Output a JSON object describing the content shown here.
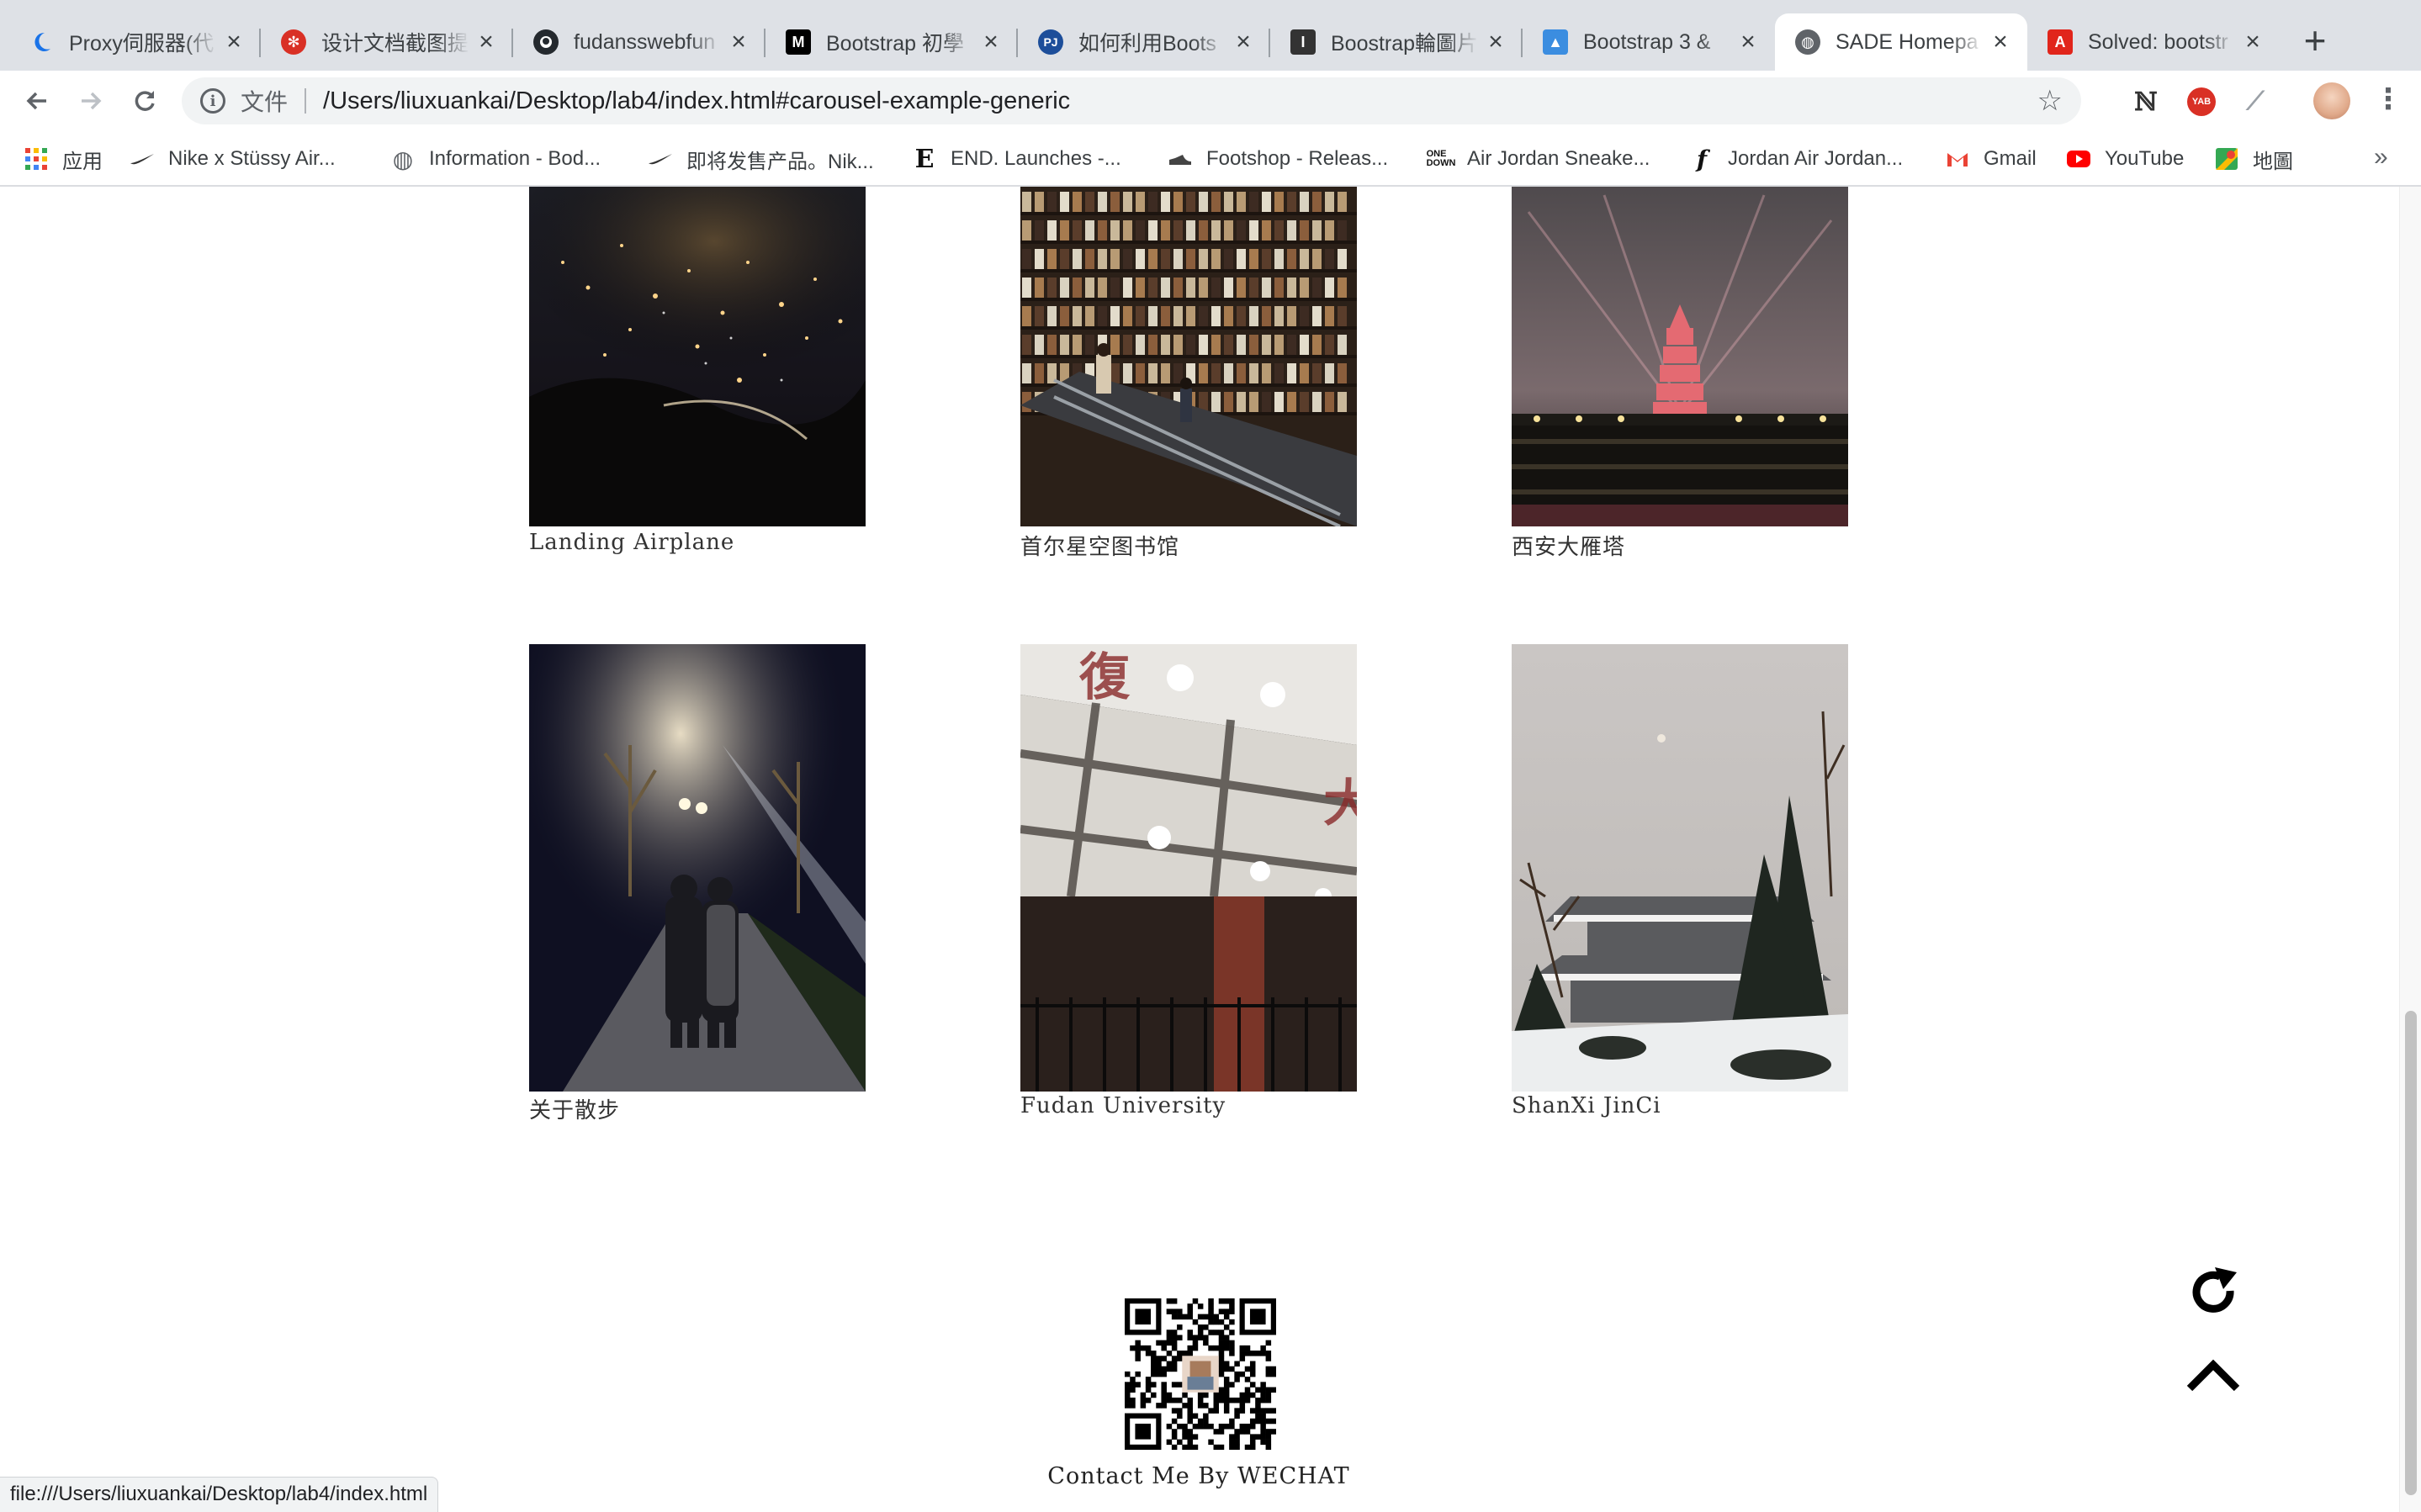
{
  "browser": {
    "tabs": [
      {
        "title": "Proxy伺服器(代",
        "icon": "proxy-moon-icon",
        "color": "#1a73e8"
      },
      {
        "title": "设计文档截图提",
        "icon": "red-snowflake-icon",
        "color": "#d93025"
      },
      {
        "title": "fudansswebfun",
        "icon": "github-icon",
        "color": "#24292e"
      },
      {
        "title": "Bootstrap 初學",
        "icon": "medium-icon",
        "color": "#000000"
      },
      {
        "title": "如何利用Boots",
        "icon": "pj-icon",
        "color": "#1d4e9a"
      },
      {
        "title": "Boostrap輪圖片",
        "icon": "blog-icon",
        "color": "#333333"
      },
      {
        "title": "Bootstrap 3 & ",
        "icon": "image-icon",
        "color": "#3b8de0"
      },
      {
        "title": "SADE Homepa",
        "icon": "globe-icon",
        "color": "#5f6368"
      },
      {
        "title": "Solved: bootstr",
        "icon": "adobe-icon",
        "color": "#e1251b"
      }
    ],
    "active_tab_index": 7,
    "new_tab_label": "+",
    "omnibox": {
      "security_label": "文件",
      "url": "/Users/liuxuankai/Desktop/lab4/index.html#carousel-example-generic"
    },
    "bookmarks": [
      {
        "label": "应用",
        "icon": "apps-grid-icon"
      },
      {
        "label": "Nike x Stüssy Air...",
        "icon": "nike-swoosh-icon"
      },
      {
        "label": "Information - Bod...",
        "icon": "globe-icon"
      },
      {
        "label": "即将发售产品。Nik...",
        "icon": "nike-swoosh-icon"
      },
      {
        "label": "END. Launches -...",
        "icon": "end-logo-icon"
      },
      {
        "label": "Footshop - Releas...",
        "icon": "footshop-icon"
      },
      {
        "label": "Air Jordan Sneake...",
        "icon": "one-block-down-icon"
      },
      {
        "label": "Jordan Air Jordan...",
        "icon": "f-logo-icon"
      },
      {
        "label": "Gmail",
        "icon": "gmail-icon"
      },
      {
        "label": "YouTube",
        "icon": "youtube-icon"
      },
      {
        "label": "地圖",
        "icon": "maps-icon"
      }
    ],
    "status_url": "file:///Users/liuxuankai/Desktop/lab4/index.html"
  },
  "gallery": {
    "items": [
      {
        "caption": "Landing Airplane",
        "image": "night-city-lights"
      },
      {
        "caption": "首尔星空图书馆",
        "image": "library-escalator"
      },
      {
        "caption": "西安大雁塔",
        "image": "lit-pagoda-at-night"
      },
      {
        "caption": "关于散步",
        "image": "couple-walking-at-night"
      },
      {
        "caption": "Fudan University",
        "image": "building-entrance-ceiling-lights"
      },
      {
        "caption": "ShanXi JinCi",
        "image": "snowy-temple-and-trees"
      }
    ]
  },
  "footer": {
    "contact_text": "Contact Me By WECHAT",
    "qr_image": "wechat-qr-code"
  },
  "floating_buttons": {
    "refresh_icon": "refresh-icon",
    "top_icon": "chevron-up-icon"
  }
}
